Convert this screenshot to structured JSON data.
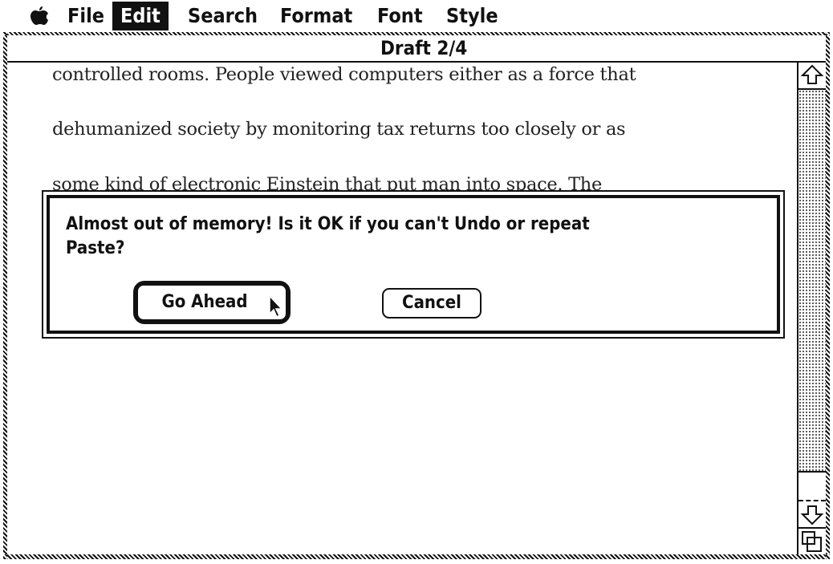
{
  "menubar": {
    "apple_icon": "apple-menu-icon",
    "items": [
      {
        "label": "File",
        "active": false
      },
      {
        "label": "Edit",
        "active": true
      },
      {
        "label": "Search",
        "active": false
      },
      {
        "label": "Format",
        "active": false
      },
      {
        "label": "Font",
        "active": false
      },
      {
        "label": "Style",
        "active": false
      }
    ]
  },
  "window": {
    "title": "Draft 2/4",
    "document_lines": [
      "controlled rooms.  People viewed computers either as a force that",
      "dehumanized society by monitoring tax returns too closely or as",
      "some kind of electronic Einstein that put man into space.  The"
    ]
  },
  "dialog": {
    "message_line1": "Almost out of memory!  Is it OK if you can't Undo or repeat",
    "message_line2": "Paste?",
    "default_button": "Go Ahead",
    "cancel_button": "Cancel"
  },
  "scrollbar": {
    "up_icon": "scroll-up-arrow-icon",
    "down_icon": "scroll-down-arrow-icon",
    "grow_icon": "size-box-icon"
  }
}
